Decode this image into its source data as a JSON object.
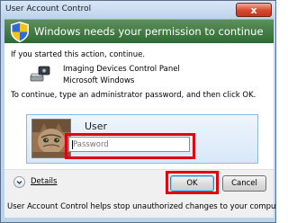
{
  "window": {
    "title": "User Account Control",
    "close_glyph": "x"
  },
  "banner": {
    "heading": "Windows needs your permission to continue",
    "icon": "uac-shield-icon"
  },
  "intro_text": "If you started this action, continue.",
  "program": {
    "name": "Imaging Devices Control Panel",
    "publisher": "Microsoft Windows",
    "icon": "scanner-camera-icon"
  },
  "instruction_text": "To continue, type an administrator password, and then click OK.",
  "credential": {
    "user_name": "User",
    "avatar_icon": "kitten-avatar-icon",
    "password_placeholder": "Password",
    "password_value": ""
  },
  "footer": {
    "details_label": "Details",
    "ok_label": "OK",
    "cancel_label": "Cancel",
    "info_text": "User Account Control helps stop unauthorized changes to your computer."
  },
  "colors": {
    "highlight_red": "#e00010",
    "banner_green": "#2b6933",
    "panel_blue": "#d8e8f8"
  }
}
